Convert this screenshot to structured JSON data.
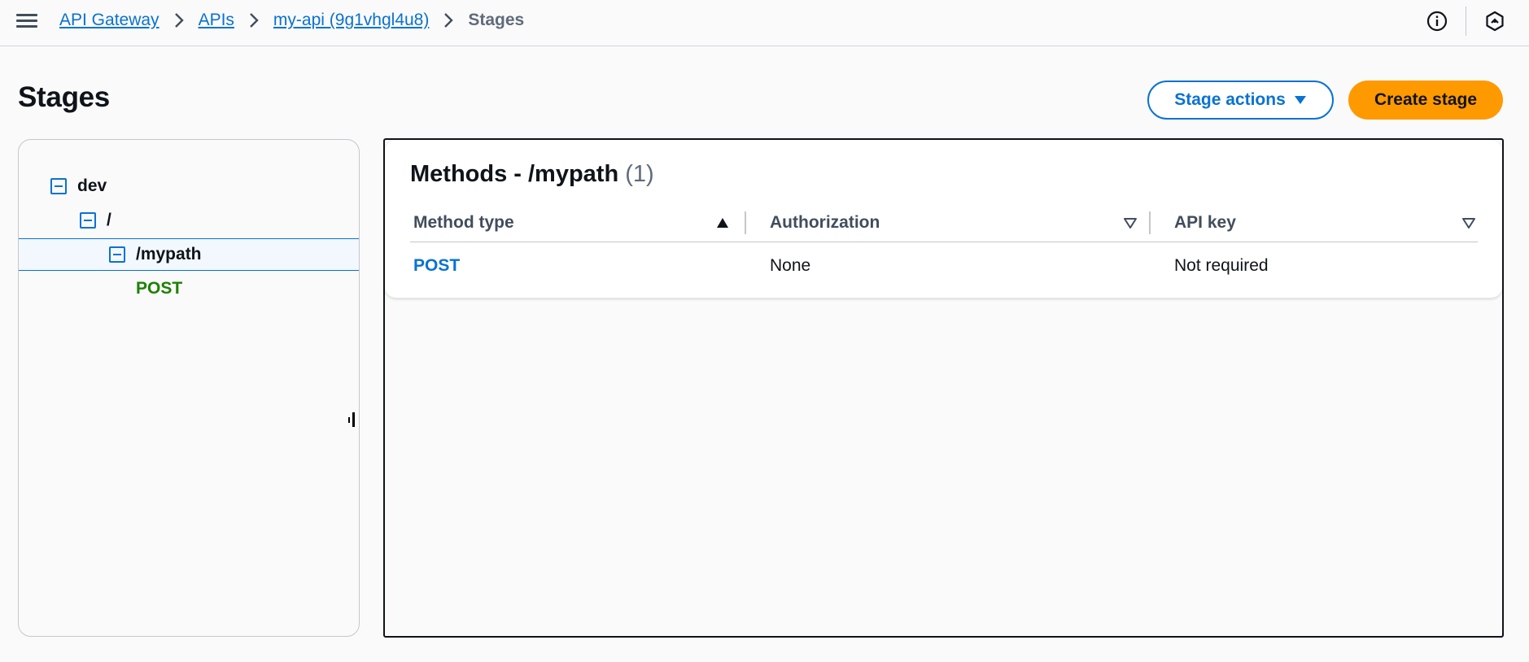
{
  "breadcrumbs": {
    "items": [
      {
        "label": "API Gateway"
      },
      {
        "label": "APIs"
      },
      {
        "label": "my-api (9g1vhgl4u8)"
      }
    ],
    "current": "Stages"
  },
  "icons": {
    "menu": "hamburger-menu-icon",
    "info": "info-icon",
    "notifications": "hexagon-settings-icon",
    "separator": "chevron-right-icon",
    "dropdown": "caret-down-icon",
    "tree_toggle": "collapse-square-icon"
  },
  "header": {
    "title": "Stages",
    "stage_actions_label": "Stage actions",
    "create_stage_label": "Create stage"
  },
  "tree": {
    "stage": "dev",
    "root_resource": "/",
    "resource": "/mypath",
    "method": "POST"
  },
  "methods": {
    "title": "Methods - /mypath",
    "count": "(1)",
    "columns": [
      "Method type",
      "Authorization",
      "API key"
    ],
    "rows": [
      {
        "method": "POST",
        "authorization": "None",
        "api_key": "Not required"
      }
    ]
  },
  "colors": {
    "link": "#0972d3",
    "primary_button": "#ff9900",
    "method_post": "#1d8102",
    "selected_row_bg": "#f2f8fd"
  }
}
